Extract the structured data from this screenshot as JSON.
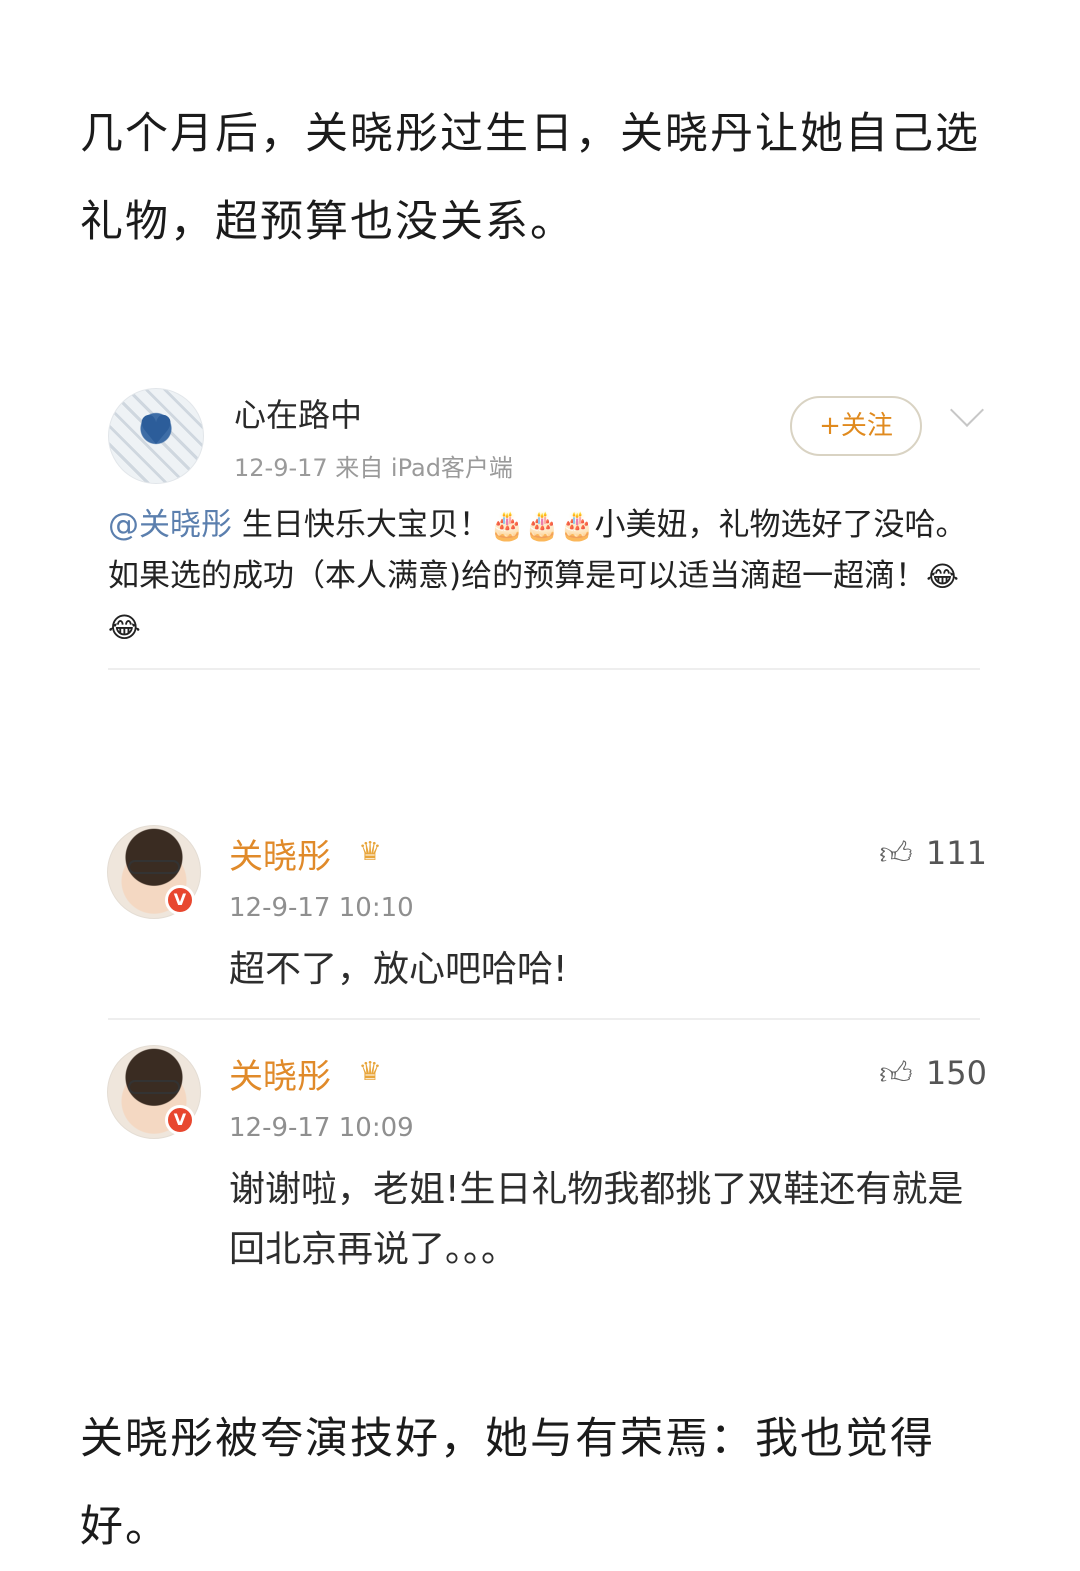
{
  "intro_text": "几个月后，关晓彤过生日，关晓丹让她自己选礼物，超预算也没关系。",
  "post": {
    "username": "心在路中",
    "meta": "12-9-17  来自 iPad客户端",
    "follow_label": "+关注",
    "mention": "@关晓彤",
    "body_part1": " 生日快乐大宝贝！",
    "emoji_cakes": "🎂🎂🎂",
    "body_part2": "小美妞，礼物选好了没哈。如果选的成功（本人满意)给的预算是可以适当滴超一超滴！",
    "emoji_laugh": "😂😂"
  },
  "comments": [
    {
      "username": "关晓彤",
      "time": "12-9-17 10:10",
      "likes": "111",
      "text": "超不了，放心吧哈哈!"
    },
    {
      "username": "关晓彤",
      "time": "12-9-17 10:09",
      "likes": "150",
      "text": "谢谢啦，老姐!生日礼物我都挑了双鞋还有就是回北京再说了。。。"
    }
  ],
  "outro_text": "关晓彤被夸演技好，她与有荣焉：我也觉得好。",
  "icons": {
    "like": "thumbs-up-icon",
    "crown": "crown-icon",
    "verified": "verified-v-icon",
    "chevron": "chevron-down-icon"
  },
  "colors": {
    "username_comment": "#e08a2a",
    "mention": "#5b7fae",
    "follow_text": "#e08a1e",
    "verified_badge": "#e8472f"
  }
}
